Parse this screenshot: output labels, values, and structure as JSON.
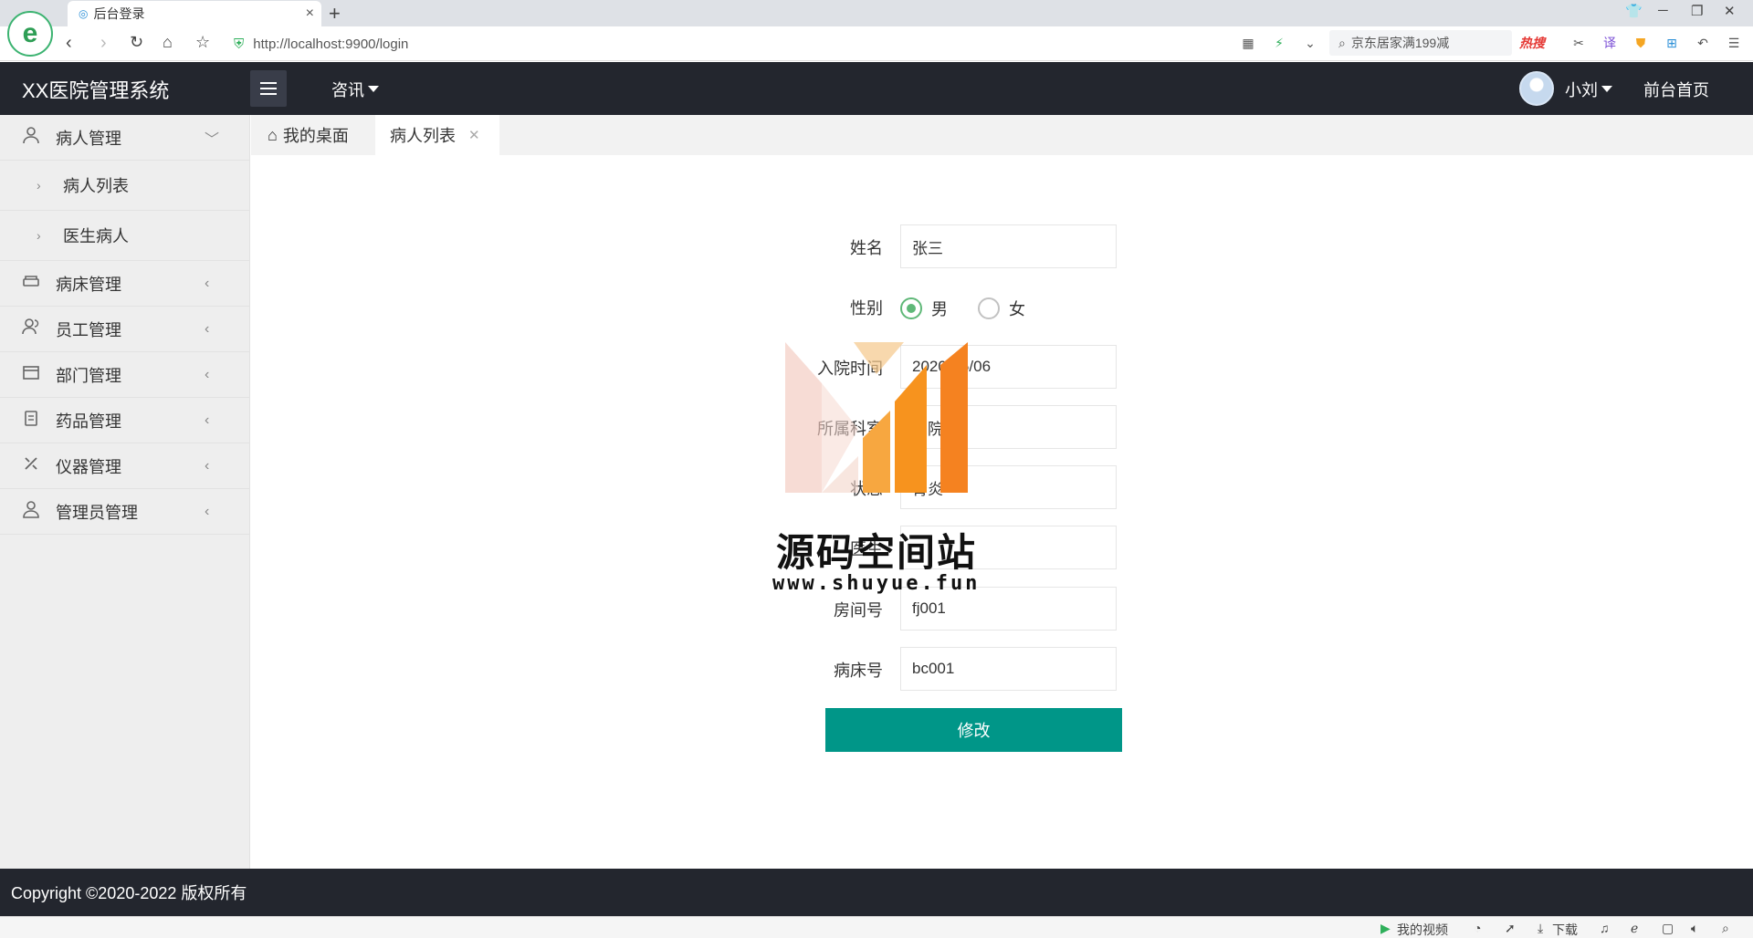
{
  "browser": {
    "tab_title": "后台登录",
    "url": "http://localhost:9900/login",
    "search_hint": "京东居家满199减",
    "hot_label": "热搜",
    "status_video": "我的视频",
    "status_download": "下载"
  },
  "header": {
    "logo": "XX医院管理系统",
    "nav_news": "咨讯",
    "user_name": "小刘",
    "front_home": "前台首页"
  },
  "sidebar": {
    "groups": [
      {
        "label": "病人管理",
        "icon": "user-icon"
      },
      {
        "label": "病床管理",
        "icon": "bed-icon"
      },
      {
        "label": "员工管理",
        "icon": "staff-icon"
      },
      {
        "label": "部门管理",
        "icon": "department-icon"
      },
      {
        "label": "药品管理",
        "icon": "medicine-icon"
      },
      {
        "label": "仪器管理",
        "icon": "tools-icon"
      },
      {
        "label": "管理员管理",
        "icon": "admin-icon"
      }
    ],
    "sub_items": [
      {
        "label": "病人列表"
      },
      {
        "label": "医生病人"
      }
    ]
  },
  "tabs": [
    {
      "label": "我的桌面"
    },
    {
      "label": "病人列表"
    }
  ],
  "form": {
    "name_label": "姓名",
    "name_value": "张三",
    "gender_label": "性别",
    "gender_male": "男",
    "gender_female": "女",
    "gender_selected": "男",
    "admit_label": "入院时间",
    "admit_value": "2020-05/06",
    "dept_label": "所属科室",
    "dept_value": "内院",
    "condition_label": "状态",
    "condition_value": "肾炎",
    "doctor_label": "医生",
    "doctor_value": "",
    "room_label": "房间号",
    "room_value": "fj001",
    "bed_label": "病床号",
    "bed_value": "bc001",
    "submit": "修改"
  },
  "watermark": {
    "title": "源码空间站",
    "url": "www.shuyue.fun"
  },
  "footer": {
    "copyright": "Copyright ©2020-2022 版权所有"
  },
  "colors": {
    "header_bg": "#23262e",
    "primary_button": "#009688",
    "radio_checked": "#5fb878",
    "watermark_orange": "#f7931e"
  }
}
